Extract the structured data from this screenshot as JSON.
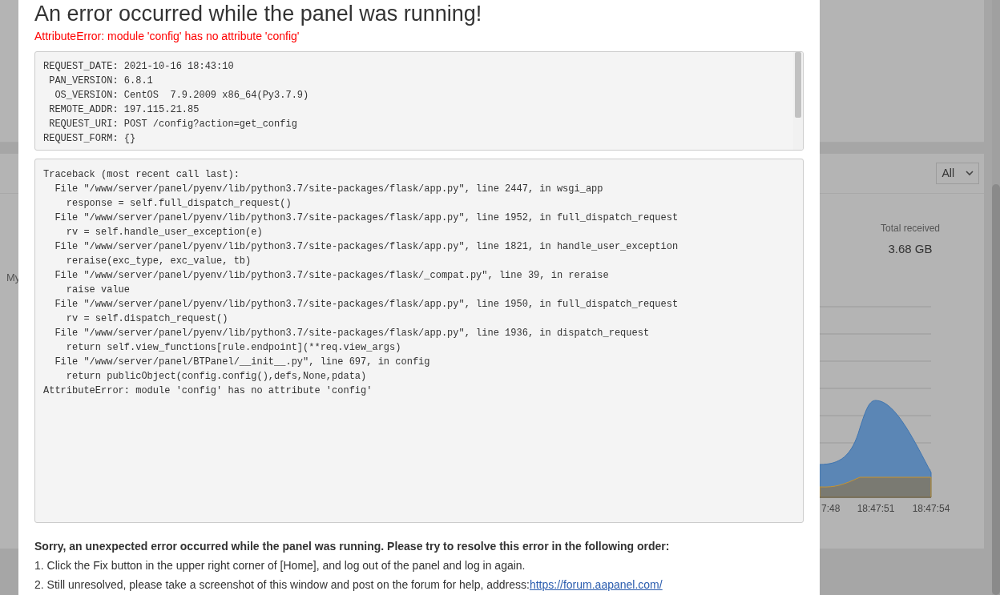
{
  "background": {
    "side_label": "My",
    "filter_select": {
      "value": "All"
    },
    "total_received": {
      "label": "Total received",
      "value": "3.68 GB"
    },
    "chart": {
      "x_labels": [
        "7:48",
        "18:47:51",
        "18:47:54"
      ]
    }
  },
  "dialog": {
    "title": "An error occurred while the panel was running!",
    "error": "AttributeError: module 'config' has no attribute 'config'",
    "request_info": [
      "REQUEST_DATE: 2021-10-16 18:43:10",
      " PAN_VERSION: 6.8.1",
      "  OS_VERSION: CentOS  7.9.2009 x86_64(Py3.7.9)",
      " REMOTE_ADDR: 197.115.21.85",
      " REQUEST_URI: POST /config?action=get_config",
      "REQUEST_FORM: {}"
    ],
    "traceback": [
      "Traceback (most recent call last):",
      "  File \"/www/server/panel/pyenv/lib/python3.7/site-packages/flask/app.py\", line 2447, in wsgi_app",
      "    response = self.full_dispatch_request()",
      "  File \"/www/server/panel/pyenv/lib/python3.7/site-packages/flask/app.py\", line 1952, in full_dispatch_request",
      "    rv = self.handle_user_exception(e)",
      "  File \"/www/server/panel/pyenv/lib/python3.7/site-packages/flask/app.py\", line 1821, in handle_user_exception",
      "    reraise(exc_type, exc_value, tb)",
      "  File \"/www/server/panel/pyenv/lib/python3.7/site-packages/flask/_compat.py\", line 39, in reraise",
      "    raise value",
      "  File \"/www/server/panel/pyenv/lib/python3.7/site-packages/flask/app.py\", line 1950, in full_dispatch_request",
      "    rv = self.dispatch_request()",
      "  File \"/www/server/panel/pyenv/lib/python3.7/site-packages/flask/app.py\", line 1936, in dispatch_request",
      "    return self.view_functions[rule.endpoint](**req.view_args)",
      "  File \"/www/server/panel/BTPanel/__init__.py\", line 697, in config",
      "    return publicObject(config.config(),defs,None,pdata)",
      "AttributeError: module 'config' has no attribute 'config'"
    ],
    "help": {
      "heading": "Sorry, an unexpected error occurred while the panel was running. Please try to resolve this error in the following order:",
      "steps": [
        {
          "text": "1. Click the Fix button in the upper right corner of [Home], and log out of the panel and log in again."
        },
        {
          "text": "2. Still unresolved, please take a screenshot of this window and post on the forum for help, address:",
          "link": "https://forum.aapanel.com/"
        }
      ]
    }
  }
}
